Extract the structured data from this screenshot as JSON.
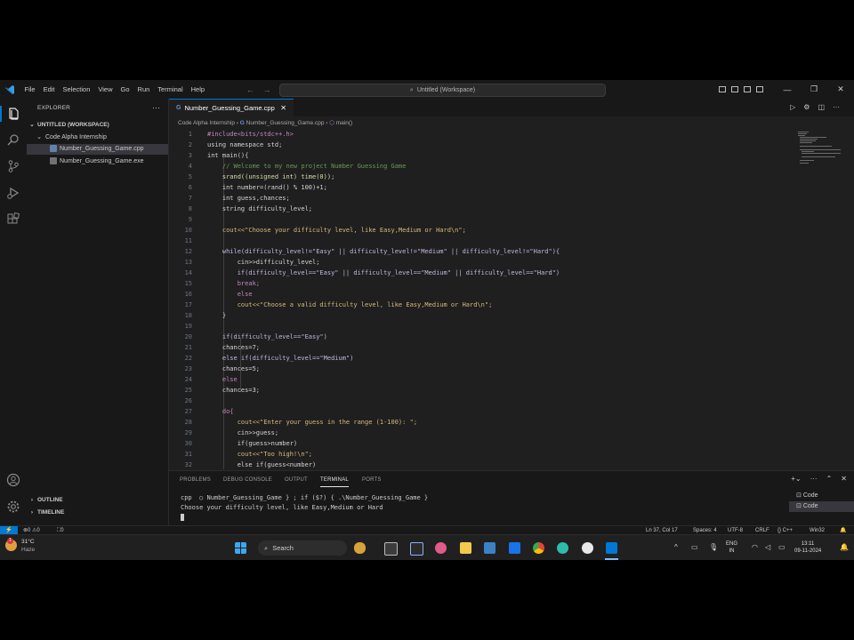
{
  "titlebar": {
    "menu": [
      "File",
      "Edit",
      "Selection",
      "View",
      "Go",
      "Run",
      "Terminal",
      "Help"
    ],
    "search_text": "Untitled (Workspace)"
  },
  "sidebar": {
    "title": "EXPLORER",
    "workspace": "UNTITLED (WORKSPACE)",
    "folder": "Code Alpha Internship",
    "files": [
      "Number_Guessing_Game.cpp",
      "Number_Guessing_Game.exe"
    ],
    "outline": "OUTLINE",
    "timeline": "TIMELINE"
  },
  "editor": {
    "tab_label": "Number_Guessing_Game.cpp",
    "breadcrumb": [
      "Code Alpha Internship",
      "Number_Guessing_Game.cpp",
      "main()"
    ],
    "lines": [
      {
        "n": "1",
        "t": "#include<bits/stdc++.h>",
        "c": "#c586c0"
      },
      {
        "n": "2",
        "t": "using namespace std;",
        "c": "#d4d4d4"
      },
      {
        "n": "3",
        "t": "int main(){",
        "c": "#d4d4d4"
      },
      {
        "n": "4",
        "t": "    // Welcome to my new project Number Guessing Game",
        "c": "#6a9955"
      },
      {
        "n": "5",
        "t": "    srand((unsigned int) time(0));",
        "c": "#dcdcaa"
      },
      {
        "n": "6",
        "t": "    int number=(rand() % 100)+1;",
        "c": "#d4d4d4"
      },
      {
        "n": "7",
        "t": "    int guess,chances;",
        "c": "#d4d4d4"
      },
      {
        "n": "8",
        "t": "    string difficulty_level;",
        "c": "#d4d4d4"
      },
      {
        "n": "9",
        "t": "",
        "c": "#d4d4d4"
      },
      {
        "n": "10",
        "t": "    cout<<\"Choose your difficulty level, like Easy,Medium or Hard\\n\";",
        "c": "#d7ba7d"
      },
      {
        "n": "11",
        "t": "",
        "c": "#d4d4d4"
      },
      {
        "n": "12",
        "t": "    while(difficulty_level!=\"Easy\" || difficulty_level!=\"Medium\" || difficulty_level!=\"Hard\"){",
        "c": "#c5b7e0"
      },
      {
        "n": "13",
        "t": "        cin>>difficulty_level;",
        "c": "#d4d4d4"
      },
      {
        "n": "14",
        "t": "        if(difficulty_level==\"Easy\" || difficulty_level==\"Medium\" || difficulty_level==\"Hard\")",
        "c": "#c5b7e0"
      },
      {
        "n": "15",
        "t": "        break;",
        "c": "#c586c0"
      },
      {
        "n": "16",
        "t": "        else",
        "c": "#c586c0"
      },
      {
        "n": "17",
        "t": "        cout<<\"Choose a valid difficulty level, like Easy,Medium or Hard\\n\";",
        "c": "#d7ba7d"
      },
      {
        "n": "18",
        "t": "    }",
        "c": "#d4d4d4"
      },
      {
        "n": "19",
        "t": "",
        "c": "#d4d4d4"
      },
      {
        "n": "20",
        "t": "    if(difficulty_level==\"Easy\")",
        "c": "#c5b7e0"
      },
      {
        "n": "21",
        "t": "    chances=7;",
        "c": "#d4d4d4"
      },
      {
        "n": "22",
        "t": "    else if(difficulty_level==\"Medium\")",
        "c": "#c5b7e0"
      },
      {
        "n": "23",
        "t": "    chances=5;",
        "c": "#d4d4d4"
      },
      {
        "n": "24",
        "t": "    else",
        "c": "#c586c0"
      },
      {
        "n": "25",
        "t": "    chances=3;",
        "c": "#d4d4d4"
      },
      {
        "n": "26",
        "t": "",
        "c": "#d4d4d4"
      },
      {
        "n": "27",
        "t": "    do{",
        "c": "#c586c0"
      },
      {
        "n": "28",
        "t": "        cout<<\"Enter your guess in the range (1-100): \";",
        "c": "#d7ba7d"
      },
      {
        "n": "29",
        "t": "        cin>>guess;",
        "c": "#d4d4d4"
      },
      {
        "n": "30",
        "t": "        if(guess>number)",
        "c": "#d4d4d4"
      },
      {
        "n": "31",
        "t": "        cout<<\"Too high!\\n\";",
        "c": "#d7ba7d"
      },
      {
        "n": "32",
        "t": "        else if(guess<number)",
        "c": "#d4d4d4"
      }
    ]
  },
  "panel": {
    "tabs": [
      "PROBLEMS",
      "DEBUG CONSOLE",
      "OUTPUT",
      "TERMINAL",
      "PORTS"
    ],
    "active_tab": "TERMINAL",
    "terminal_lines": [
      "cpp  ○ Number_Guessing_Game } ; if ($?) { .\\Number_Guessing_Game }",
      "Choose your difficulty level, like Easy,Medium or Hard"
    ],
    "terminals": [
      "Code",
      "Code"
    ]
  },
  "statusbar": {
    "problems": "⊗0 ⚠0",
    "ports": "⛶0",
    "position": "Ln 37, Col 17",
    "spaces": "Spaces: 4",
    "encoding": "UTF-8",
    "eol": "CRLF",
    "language": "{} C++",
    "platform": "Win32"
  },
  "taskbar": {
    "weather_temp": "31°C",
    "weather_desc": "Haze",
    "search": "Search",
    "lang_top": "ENG",
    "lang_bottom": "IN",
    "time": "13:11",
    "date": "09-11-2024"
  },
  "colors": {
    "accent": "#0078d4",
    "editor_bg": "#1f1f1f",
    "chrome_bg": "#181818"
  }
}
